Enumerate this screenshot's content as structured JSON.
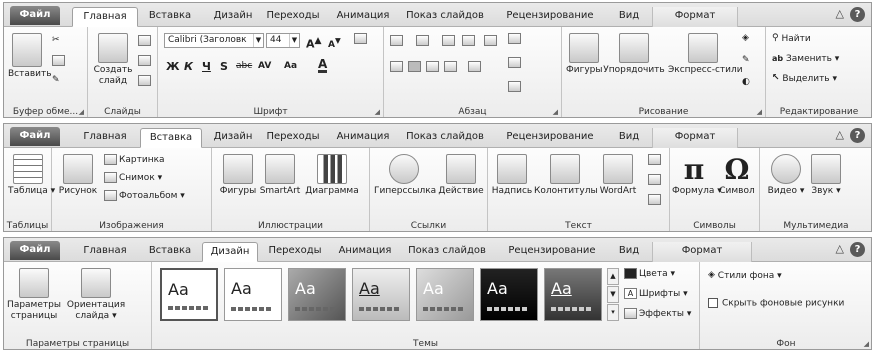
{
  "r1": {
    "tabs": {
      "file": "Файл",
      "home": "Главная",
      "insert": "Вставка",
      "design": "Дизайн",
      "transitions": "Переходы",
      "animation": "Анимация",
      "slideshow": "Показ слайдов",
      "review": "Рецензирование",
      "view": "Вид",
      "format": "Формат"
    },
    "groups": {
      "clipboard": "Буфер обме...",
      "slides": "Слайды",
      "font": "Шрифт",
      "paragraph": "Абзац",
      "drawing": "Рисование",
      "editing": "Редактирование"
    },
    "paste": "Вставить",
    "newslide": "Создать слайд",
    "fontname": "Calibri (Заголовк",
    "fontsize": "44",
    "shapes": "Фигуры",
    "arrange": "Упорядочить",
    "quickstyles": "Экспресс-стили",
    "find": "Найти",
    "replace": "Заменить",
    "select": "Выделить"
  },
  "r2": {
    "tabs": {
      "file": "Файл",
      "home": "Главная",
      "insert": "Вставка",
      "design": "Дизайн",
      "transitions": "Переходы",
      "animation": "Анимация",
      "slideshow": "Показ слайдов",
      "review": "Рецензирование",
      "view": "Вид",
      "format": "Формат"
    },
    "groups": {
      "tables": "Таблицы",
      "images": "Изображения",
      "illustrations": "Иллюстрации",
      "links": "Ссылки",
      "text": "Текст",
      "symbols": "Символы",
      "media": "Мультимедиа"
    },
    "table": "Таблица",
    "picture": "Рисунок",
    "clipart": "Картинка",
    "screenshot": "Снимок",
    "album": "Фотоальбом",
    "shapes": "Фигуры",
    "smartart": "SmartArt",
    "chart": "Диаграмма",
    "hyperlink": "Гиперссылка",
    "action": "Действие",
    "textbox": "Надпись",
    "headerfooter": "Колонтитулы",
    "wordart": "WordArt",
    "equation": "Формула",
    "symbol": "Символ",
    "video": "Видео",
    "audio": "Звук"
  },
  "r3": {
    "tabs": {
      "file": "Файл",
      "home": "Главная",
      "insert": "Вставка",
      "design": "Дизайн",
      "transitions": "Переходы",
      "animation": "Анимация",
      "slideshow": "Показ слайдов",
      "review": "Рецензирование",
      "view": "Вид",
      "format": "Формат"
    },
    "groups": {
      "pagesetup": "Параметры страницы",
      "themes": "Темы",
      "background": "Фон"
    },
    "pagesetup": "Параметры страницы",
    "orientation": "Ориентация слайда",
    "themeText": "Aa",
    "colors": "Цвета",
    "fonts": "Шрифты",
    "effects": "Эффекты",
    "bgstyles": "Стили фона",
    "hidebg": "Скрыть фоновые рисунки"
  },
  "help": "?",
  "minimize": "△"
}
